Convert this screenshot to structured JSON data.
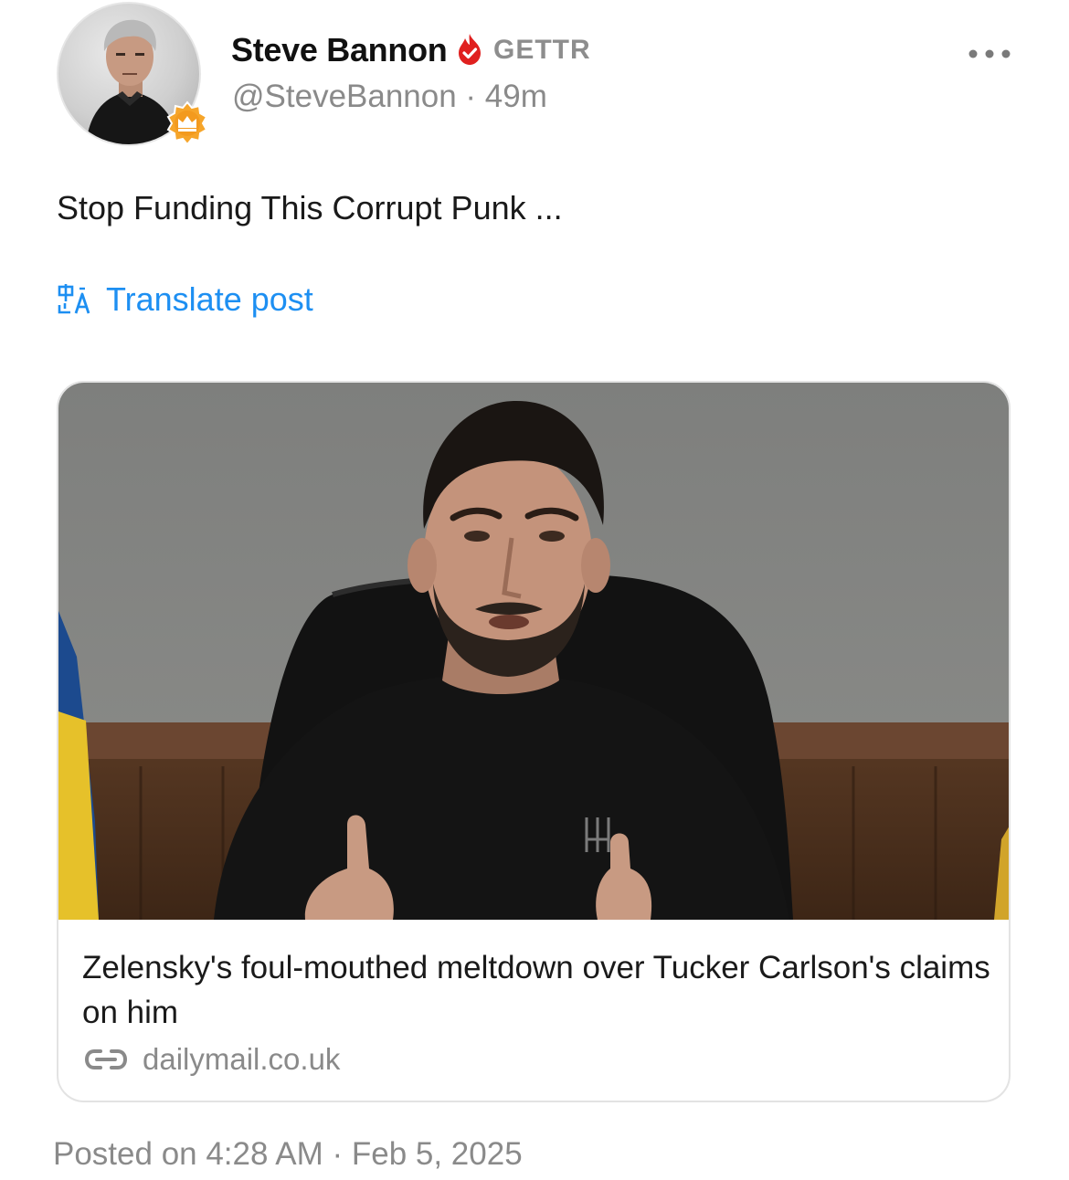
{
  "author": {
    "name": "Steve Bannon",
    "platform": "GETTR",
    "handle": "@SteveBannon",
    "time_ago": "49m",
    "handle_line": "@SteveBannon · 49m"
  },
  "post": {
    "text": "Stop Funding This Corrupt Punk ...",
    "translate_label": "Translate post"
  },
  "link_card": {
    "title": "Zelensky's foul-mouthed meltdown over Tucker Carlson's claims on him",
    "source": "dailymail.co.uk"
  },
  "footer": {
    "posted_on": "Posted on 4:28 AM · Feb 5, 2025"
  },
  "colors": {
    "accent_blue": "#1d8ff2",
    "verified_red": "#e0201f",
    "badge_orange": "#f39a1e",
    "muted_gray": "#8a8a8a"
  },
  "icons": {
    "verified": "verified-flame-check-icon",
    "badge": "crown-badge-icon",
    "more": "more-dots-icon",
    "translate": "translate-icon",
    "link": "link-icon"
  }
}
